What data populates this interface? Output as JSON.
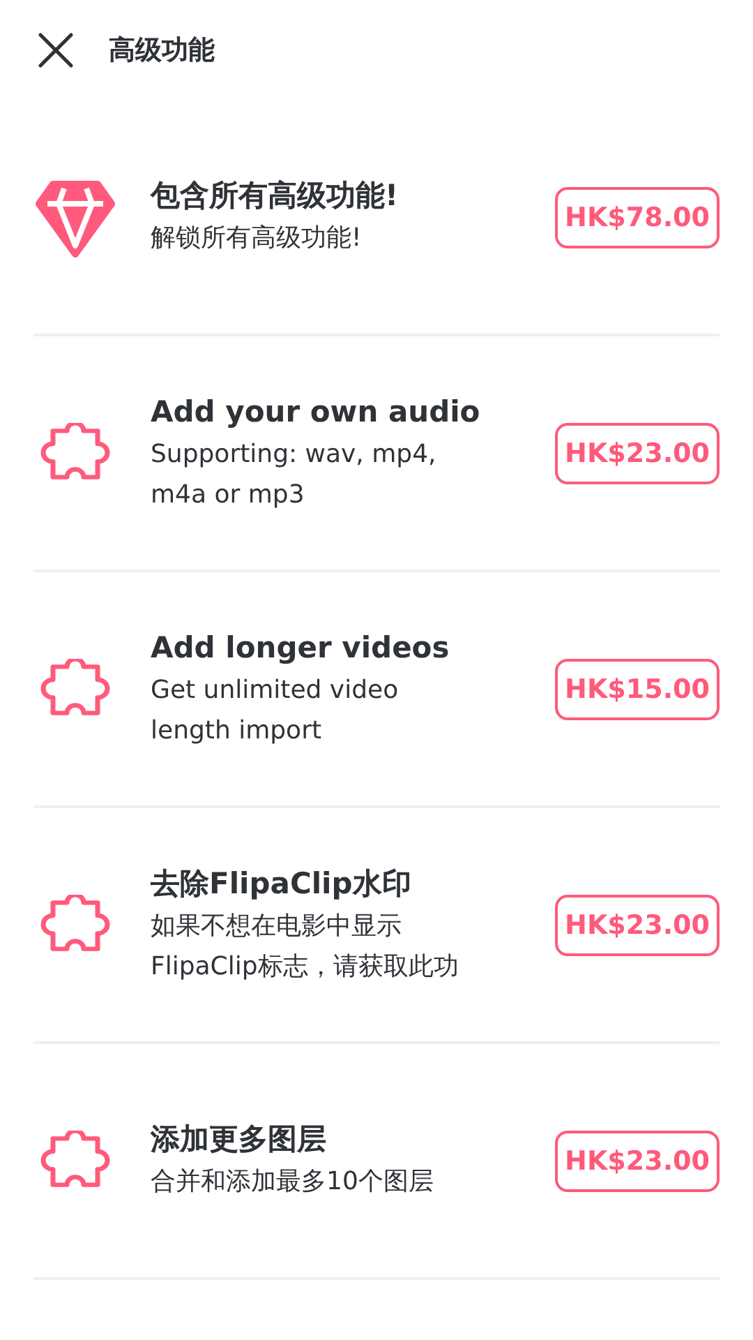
{
  "header": {
    "title": "高级功能"
  },
  "features": [
    {
      "kind": "diamond",
      "title": "包含所有高级功能!",
      "description": [
        "解锁所有高级功能!"
      ],
      "price": "HK$78.00"
    },
    {
      "kind": "puzzle",
      "title": "Add your own audio",
      "description": [
        "Supporting: wav, mp4,",
        "m4a or mp3"
      ],
      "price": "HK$23.00"
    },
    {
      "kind": "puzzle",
      "title": "Add longer videos",
      "description": [
        "Get unlimited video",
        "length import"
      ],
      "price": "HK$15.00"
    },
    {
      "kind": "puzzle",
      "title": "去除FlipaClip水印",
      "description": [
        "如果不想在电影中显示",
        "FlipaClip标志，请获取此功"
      ],
      "price": "HK$23.00"
    },
    {
      "kind": "puzzle",
      "title": "添加更多图层",
      "description": [
        "合并和添加最多10个图层"
      ],
      "price": "HK$23.00"
    }
  ]
}
